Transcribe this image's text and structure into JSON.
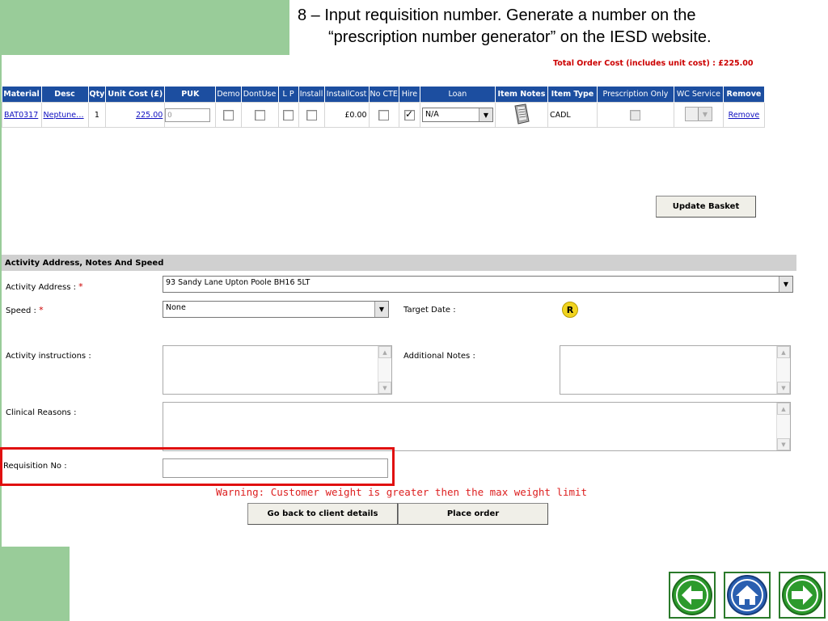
{
  "slide": {
    "title_line1": "8 – Input requisition number. Generate a number on the",
    "title_line2": "“prescription number generator” on the IESD website."
  },
  "order": {
    "total_label": "Total Order Cost (includes unit cost) : £225.00"
  },
  "basket": {
    "columns": [
      "Material",
      "Desc",
      "Qty",
      "Unit Cost (£)",
      "PUK",
      "Demo",
      "DontUse",
      "L P",
      "Install",
      "InstallCost",
      "No CTE",
      "Hire",
      "Loan",
      "Item Notes",
      "Item Type",
      "Prescription Only",
      "WC Service",
      "Remove"
    ],
    "row": {
      "material": "BAT0317",
      "desc": "Neptune…",
      "qty": "1",
      "unit_cost": "225.00",
      "puk": "0",
      "install_cost": "£0.00",
      "hire_checked": true,
      "loan": "N/A",
      "item_type": "CADL",
      "remove": "Remove"
    },
    "update_button": "Update Basket"
  },
  "activity": {
    "section_title": "Activity Address, Notes And Speed",
    "address_label": "Activity Address :",
    "address_value": "93 Sandy Lane Upton Poole BH16 5LT",
    "speed_label": "Speed :",
    "speed_value": "None",
    "target_date_label": "Target Date :",
    "r_badge": "R",
    "instructions_label": "Activity instructions :",
    "additional_notes_label": "Additional Notes :",
    "clinical_reasons_label": "Clinical Reasons :",
    "requisition_label": "Requisition No :",
    "required_mark": "*"
  },
  "warning": "Warning: Customer weight is greater then the max weight limit",
  "actions": {
    "back_button": "Go back to client details",
    "place_order_button": "Place order"
  },
  "nav": {
    "back_icon": "arrow-left-icon",
    "home_icon": "home-icon",
    "forward_icon": "arrow-right-icon"
  },
  "colors": {
    "accent_green": "#99cc99",
    "header_blue": "#1c4ea0",
    "warning_red": "#dd2020"
  }
}
